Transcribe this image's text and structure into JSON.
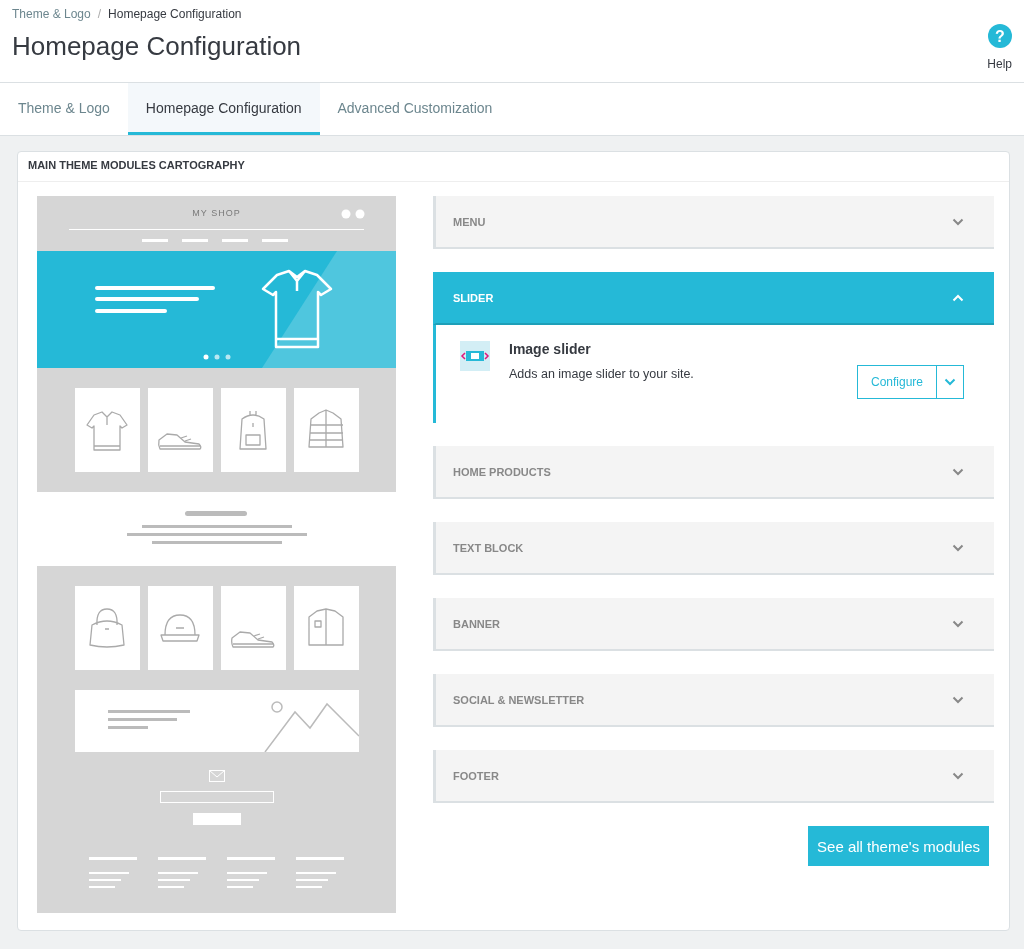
{
  "breadcrumb": {
    "separator": "/",
    "items": [
      {
        "label": "Theme & Logo"
      },
      {
        "label": "Homepage Configuration"
      }
    ]
  },
  "title": "Homepage Configuration",
  "help": {
    "icon": "?",
    "label": "Help"
  },
  "tabs": [
    {
      "label": "Theme & Logo",
      "selected": false
    },
    {
      "label": "Homepage Configuration",
      "selected": true
    },
    {
      "label": "Advanced Customization",
      "selected": false
    }
  ],
  "panel": {
    "title": "MAIN THEME MODULES CARTOGRAPHY",
    "preview": {
      "shop_name": "MY SHOP"
    },
    "sections": [
      {
        "title": "MENU",
        "expanded": false
      },
      {
        "title": "SLIDER",
        "expanded": true,
        "modules": [
          {
            "name": "Image slider",
            "description": "Adds an image slider to your site.",
            "action": "Configure"
          }
        ]
      },
      {
        "title": "HOME PRODUCTS",
        "expanded": false
      },
      {
        "title": "TEXT BLOCK",
        "expanded": false
      },
      {
        "title": "BANNER",
        "expanded": false
      },
      {
        "title": "SOCIAL & NEWSLETTER",
        "expanded": false
      },
      {
        "title": "FOOTER",
        "expanded": false
      }
    ],
    "all_modules_button": "See all theme's modules"
  }
}
